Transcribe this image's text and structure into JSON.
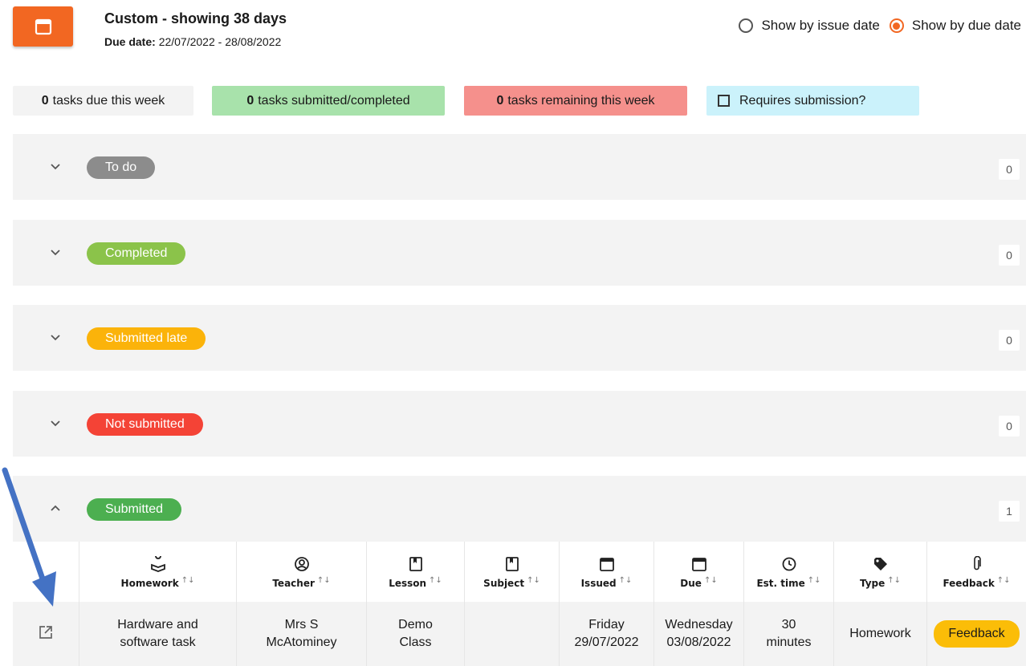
{
  "header": {
    "title": "Custom - showing 38 days",
    "subtitle_label": "Due date:",
    "subtitle_value": "22/07/2022 - 28/08/2022",
    "calendar_icon": "calendar-icon",
    "accent_color": "#f26722"
  },
  "view_options": {
    "issue_label": "Show by issue date",
    "due_label": "Show by due date",
    "selected": "due"
  },
  "stats": {
    "due_week": {
      "count": "0",
      "label": "tasks due this week"
    },
    "submitted": {
      "count": "0",
      "label": "tasks submitted/completed"
    },
    "remaining": {
      "count": "0",
      "label": "tasks remaining this week"
    },
    "requires_submission": {
      "label": "Requires submission?",
      "checked": false
    }
  },
  "groups": [
    {
      "label": "To do",
      "count": "0",
      "color": "#8c8c8c",
      "expanded": false
    },
    {
      "label": "Completed",
      "count": "0",
      "color": "#8bc34a",
      "expanded": false
    },
    {
      "label": "Submitted late",
      "count": "0",
      "color": "#fbb30a",
      "expanded": false
    },
    {
      "label": "Not submitted",
      "count": "0",
      "color": "#f44336",
      "expanded": false
    },
    {
      "label": "Submitted",
      "count": "1",
      "color": "#4caf50",
      "expanded": true
    }
  ],
  "table": {
    "columns": [
      {
        "label": "Homework",
        "icon": "book-open-icon"
      },
      {
        "label": "Teacher",
        "icon": "user-circle-icon"
      },
      {
        "label": "Lesson",
        "icon": "bookmark-book-icon"
      },
      {
        "label": "Subject",
        "icon": "bookmark-book-icon"
      },
      {
        "label": "Issued",
        "icon": "calendar-icon"
      },
      {
        "label": "Due",
        "icon": "calendar-icon"
      },
      {
        "label": "Est. time",
        "icon": "clock-icon"
      },
      {
        "label": "Type",
        "icon": "tag-icon"
      },
      {
        "label": "Feedback",
        "icon": "paperclip-icon"
      }
    ],
    "sort_glyph": "↑↓",
    "rows": [
      {
        "homework_l1": "Hardware and",
        "homework_l2": "software task",
        "teacher_l1": "Mrs S",
        "teacher_l2": "McAtominey",
        "lesson_l1": "Demo",
        "lesson_l2": "Class",
        "subject": "",
        "issued_l1": "Friday",
        "issued_l2": "29/07/2022",
        "due_l1": "Wednesday",
        "due_l2": "03/08/2022",
        "est_l1": "30",
        "est_l2": "minutes",
        "type": "Homework",
        "feedback": "Feedback"
      }
    ]
  },
  "annotation": {
    "arrow_color": "#4472c4"
  }
}
